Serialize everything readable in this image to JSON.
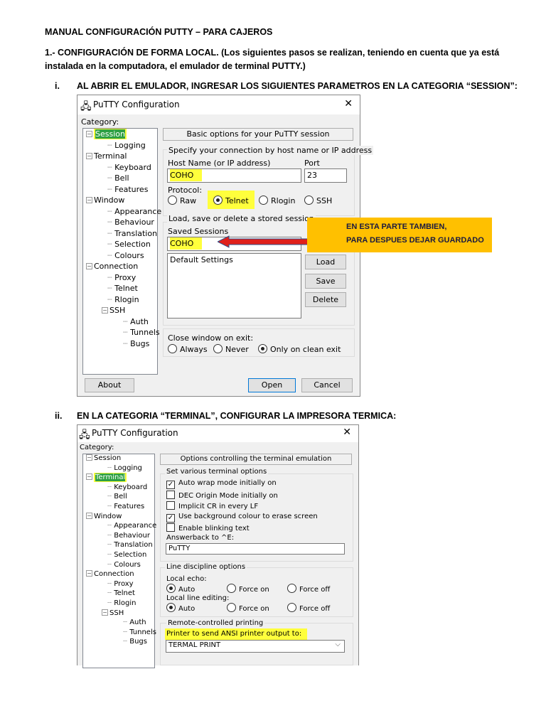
{
  "doc": {
    "title": "MANUAL CONFIGURACIÓN PUTTY – PARA CAJEROS",
    "intro_line1": "1.- CONFIGURACIÓN DE FORMA LOCAL. (Los siguientes pasos se realizan, teniendo en cuenta que ya está",
    "intro_line2": "instalada en la computadora, el emulador de terminal PUTTY.)",
    "step1_num": "i.",
    "step1_text": "AL ABRIR EL EMULADOR, INGRESAR LOS SIGUIENTES PARAMETROS EN LA CATEGORIA “SESSION”:",
    "step2_num": "ii.",
    "step2_text": "EN LA CATEGORIA “TERMINAL”, CONFIGURAR LA IMPRESORA TERMICA:"
  },
  "tree": [
    "Session",
    "Logging",
    "Terminal",
    "Keyboard",
    "Bell",
    "Features",
    "Window",
    "Appearance",
    "Behaviour",
    "Translation",
    "Selection",
    "Colours",
    "Connection",
    "Proxy",
    "Telnet",
    "Rlogin",
    "SSH",
    "Auth",
    "Tunnels",
    "Bugs"
  ],
  "dialog1": {
    "title": "PuTTY Configuration",
    "close": "✕",
    "category": "Category:",
    "header": "Basic options for your PuTTY session",
    "conn_group": "Specify your connection by host name or IP address",
    "host_label": "Host Name (or IP address)",
    "host_value": "COHO",
    "port_label": "Port",
    "port_value": "23",
    "protocol_label": "Protocol:",
    "protocols": [
      "Raw",
      "Telnet",
      "Rlogin",
      "SSH"
    ],
    "protocol_selected": "Telnet",
    "store_group": "Load, save or delete a stored session",
    "saved_label": "Saved Sessions",
    "saved_value": "COHO",
    "sessions": [
      "Default Settings"
    ],
    "load": "Load",
    "save": "Save",
    "delete": "Delete",
    "close_group": "Close window on exit:",
    "close_opts": [
      "Always",
      "Never",
      "Only on clean exit"
    ],
    "close_selected": "Only on clean exit",
    "about": "About",
    "open": "Open",
    "cancel": "Cancel"
  },
  "callout": {
    "line1": "EN ESTA PARTE TAMBIEN,",
    "line2": "PARA DESPUES DEJAR GUARDADO",
    "color": "#FFC000",
    "arrow_color": "#e0201b"
  },
  "dialog2": {
    "title": "PuTTY Configuration",
    "close": "✕",
    "category": "Category:",
    "header": "Options controlling the terminal emulation",
    "term_group": "Set various terminal options",
    "checks": [
      {
        "label": "Auto wrap mode initially on",
        "checked": true
      },
      {
        "label": "DEC Origin Mode initially on",
        "checked": false
      },
      {
        "label": "Implicit CR in every LF",
        "checked": false
      },
      {
        "label": "Use background colour to erase screen",
        "checked": true
      },
      {
        "label": "Enable blinking text",
        "checked": false
      }
    ],
    "answerback_label": "Answerback to ^E:",
    "answerback_value": "PuTTY",
    "line_group": "Line discipline options",
    "echo_label": "Local echo:",
    "edit_label": "Local line editing:",
    "opts": [
      "Auto",
      "Force on",
      "Force off"
    ],
    "print_group": "Remote-controlled printing",
    "printer_label": "Printer to send ANSI printer output to:",
    "printer_value": "TERMAL PRINT"
  }
}
